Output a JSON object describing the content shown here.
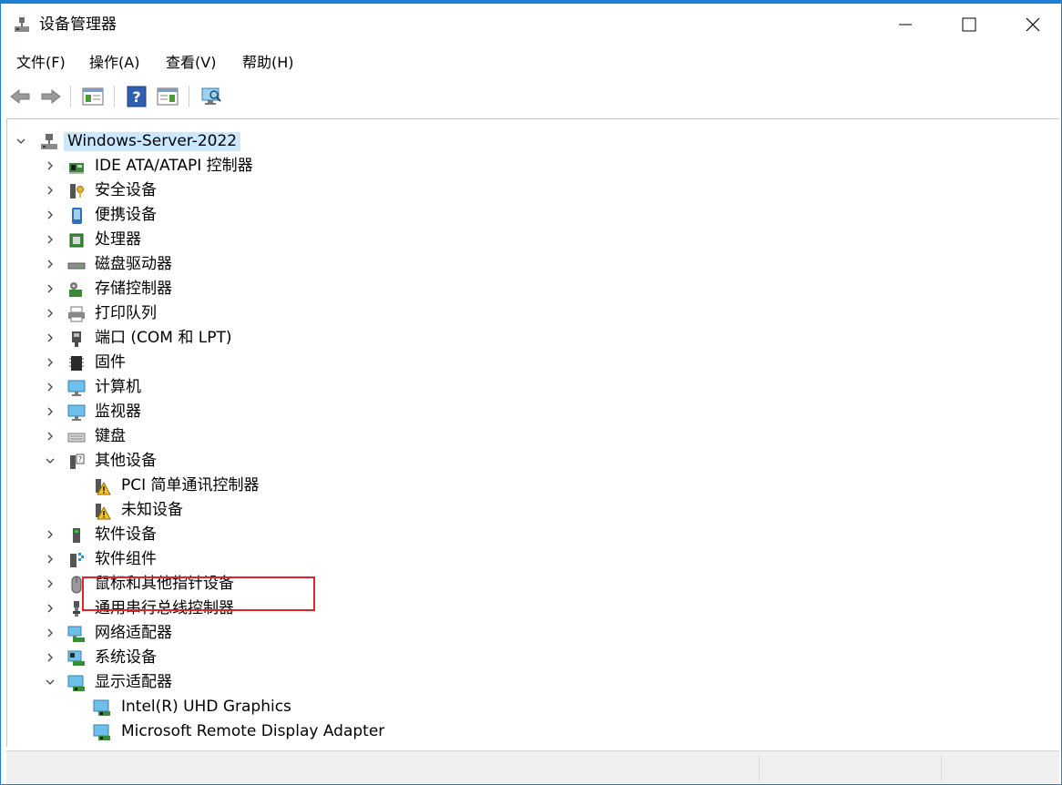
{
  "window": {
    "title": "设备管理器"
  },
  "menu": [
    "文件(F)",
    "操作(A)",
    "查看(V)",
    "帮助(H)"
  ],
  "tree": {
    "root": "Windows-Server-2022",
    "categories": [
      {
        "label": "IDE ATA/ATAPI 控制器",
        "icon": "ide-controller-icon",
        "expanded": false
      },
      {
        "label": "安全设备",
        "icon": "security-device-icon",
        "expanded": false
      },
      {
        "label": "便携设备",
        "icon": "portable-device-icon",
        "expanded": false
      },
      {
        "label": "处理器",
        "icon": "processor-icon",
        "expanded": false
      },
      {
        "label": "磁盘驱动器",
        "icon": "disk-drive-icon",
        "expanded": false
      },
      {
        "label": "存储控制器",
        "icon": "storage-controller-icon",
        "expanded": false
      },
      {
        "label": "打印队列",
        "icon": "printer-icon",
        "expanded": false
      },
      {
        "label": "端口 (COM 和 LPT)",
        "icon": "port-icon",
        "expanded": false
      },
      {
        "label": "固件",
        "icon": "firmware-icon",
        "expanded": false
      },
      {
        "label": "计算机",
        "icon": "computer-icon",
        "expanded": false
      },
      {
        "label": "监视器",
        "icon": "monitor-icon",
        "expanded": false
      },
      {
        "label": "键盘",
        "icon": "keyboard-icon",
        "expanded": false
      },
      {
        "label": "其他设备",
        "icon": "other-device-icon",
        "expanded": true,
        "children": [
          {
            "label": "PCI 简单通讯控制器",
            "icon": "warning-device-icon"
          },
          {
            "label": "未知设备",
            "icon": "warning-device-icon"
          }
        ]
      },
      {
        "label": "软件设备",
        "icon": "software-device-icon",
        "expanded": false
      },
      {
        "label": "软件组件",
        "icon": "software-component-icon",
        "expanded": false
      },
      {
        "label": "鼠标和其他指针设备",
        "icon": "mouse-icon",
        "expanded": false
      },
      {
        "label": "通用串行总线控制器",
        "icon": "usb-icon",
        "expanded": false
      },
      {
        "label": "网络适配器",
        "icon": "network-adapter-icon",
        "expanded": false
      },
      {
        "label": "系统设备",
        "icon": "system-device-icon",
        "expanded": false
      },
      {
        "label": "显示适配器",
        "icon": "display-adapter-icon",
        "expanded": true,
        "children": [
          {
            "label": "Intel(R) UHD Graphics",
            "icon": "display-adapter-icon",
            "highlighted": true
          },
          {
            "label": "Microsoft Remote Display Adapter",
            "icon": "display-adapter-icon"
          }
        ]
      }
    ]
  },
  "colors": {
    "accent": "#1f7fd0",
    "selection": "#cce8ff",
    "highlight_border": "#e0242b"
  }
}
